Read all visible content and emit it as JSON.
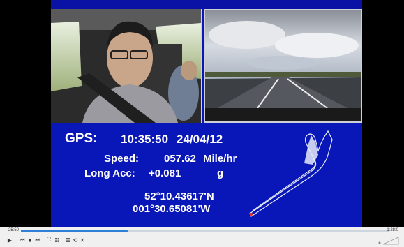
{
  "overlay": {
    "gps_label": "GPS:",
    "time": "10:35:50",
    "date": "24/04/12",
    "speed_label": "Speed:",
    "speed_value": "057.62",
    "speed_unit": "Mile/hr",
    "acc_label": "Long Acc:",
    "acc_value": "+0.081",
    "acc_unit": "g",
    "latitude": "52°10.43617'N",
    "longitude": "001°30.65081'W"
  },
  "player": {
    "elapsed": "25:50",
    "total": "1:28:0",
    "progress_fraction": 0.29
  },
  "colors": {
    "overlay_bg": "#0a17b8",
    "seek_fill": "#2f7ed8"
  },
  "icons": [
    "play-icon",
    "prev-icon",
    "stop-icon",
    "next-icon",
    "fullscreen-icon",
    "extended-settings-icon",
    "playlist-icon",
    "loop-icon",
    "shuffle-icon",
    "volume-icon"
  ]
}
